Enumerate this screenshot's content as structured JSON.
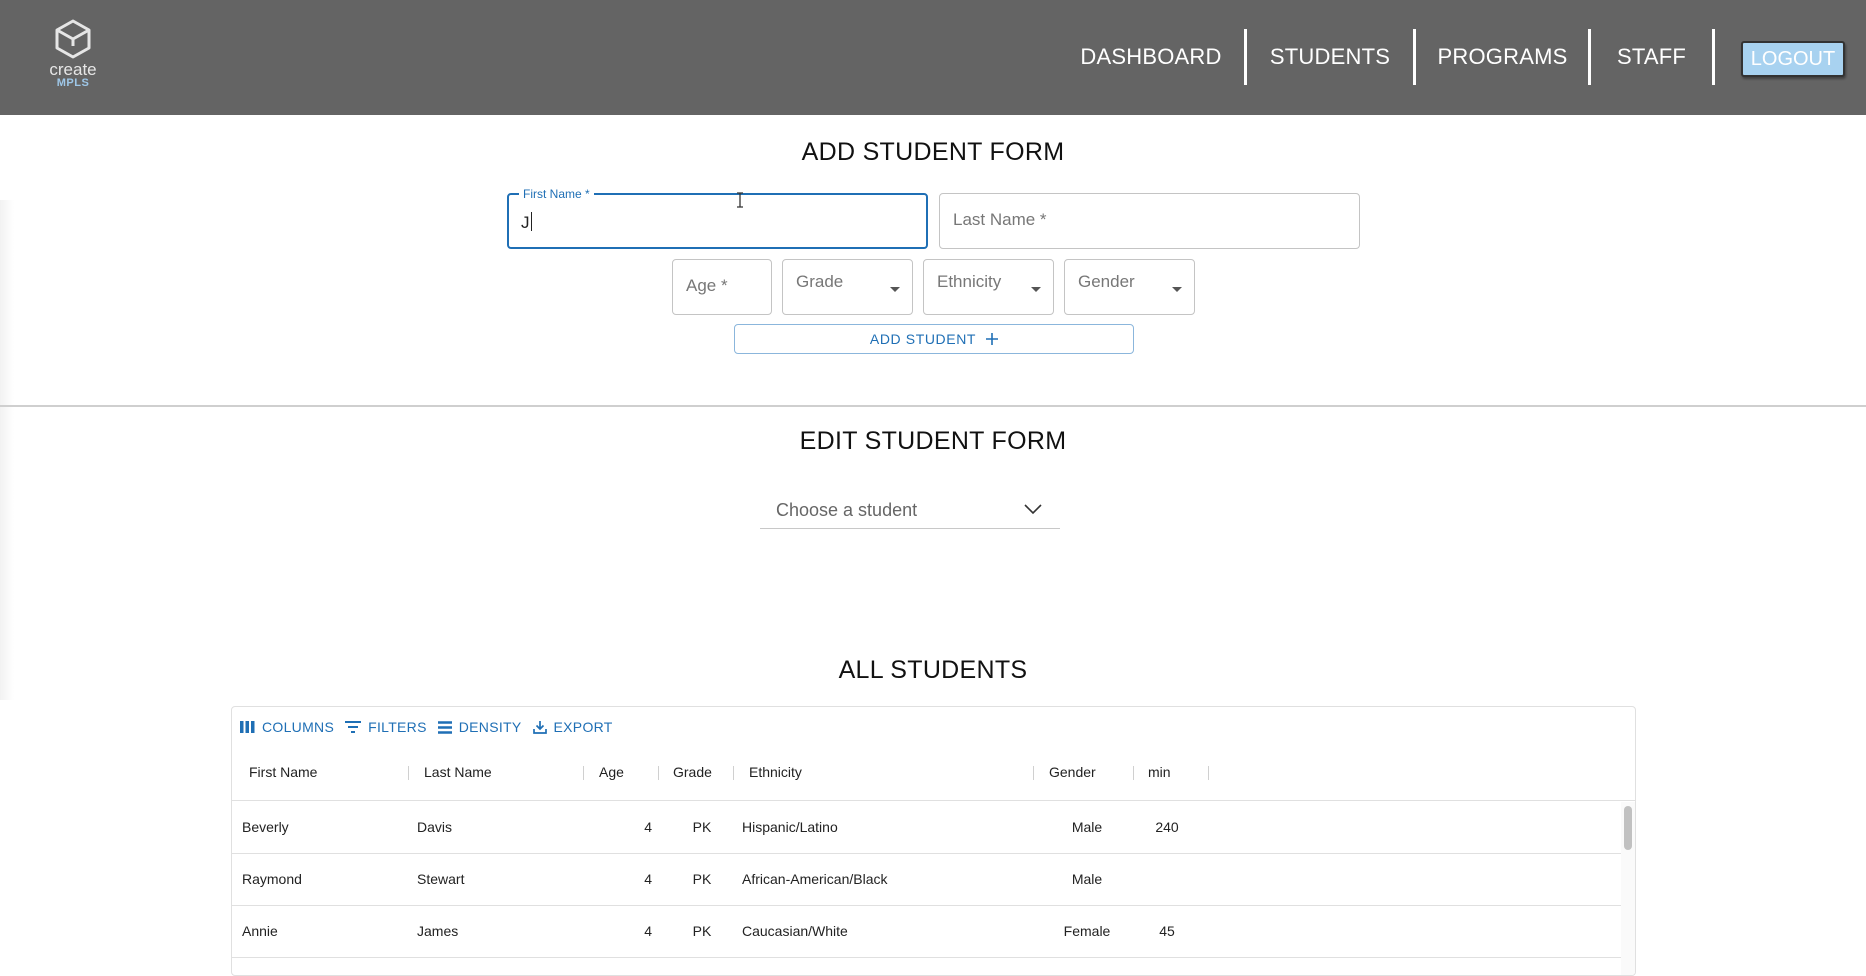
{
  "brand": {
    "word": "create",
    "sub": "MPLS"
  },
  "nav": {
    "items": [
      "DASHBOARD",
      "STUDENTS",
      "PROGRAMS",
      "STAFF"
    ],
    "logout": "LOGOUT"
  },
  "add_form": {
    "title": "ADD STUDENT FORM",
    "first_name": {
      "label": "First Name *",
      "value": "J"
    },
    "last_name": {
      "placeholder": "Last Name *"
    },
    "age": {
      "placeholder": "Age *"
    },
    "grade": {
      "placeholder": "Grade"
    },
    "ethnicity": {
      "placeholder": "Ethnicity"
    },
    "gender": {
      "placeholder": "Gender"
    },
    "submit": "ADD STUDENT"
  },
  "edit_form": {
    "title": "EDIT STUDENT FORM",
    "select_placeholder": "Choose a student"
  },
  "all_students": {
    "title": "ALL STUDENTS",
    "toolbar": [
      "COLUMNS",
      "FILTERS",
      "DENSITY",
      "EXPORT"
    ],
    "columns": [
      "First Name",
      "Last Name",
      "Age",
      "Grade",
      "Ethnicity",
      "Gender",
      "min"
    ],
    "rows": [
      [
        "Beverly",
        "Davis",
        "4",
        "PK",
        "Hispanic/Latino",
        "Male",
        "240"
      ],
      [
        "Raymond",
        "Stewart",
        "4",
        "PK",
        "African-American/Black",
        "Male",
        ""
      ],
      [
        "Annie",
        "James",
        "4",
        "PK",
        "Caucasian/White",
        "Female",
        "45"
      ]
    ]
  },
  "colors": {
    "header_bg": "#646464",
    "accent": "#1f6fb5",
    "logout_bg": "#a8d2f0"
  }
}
